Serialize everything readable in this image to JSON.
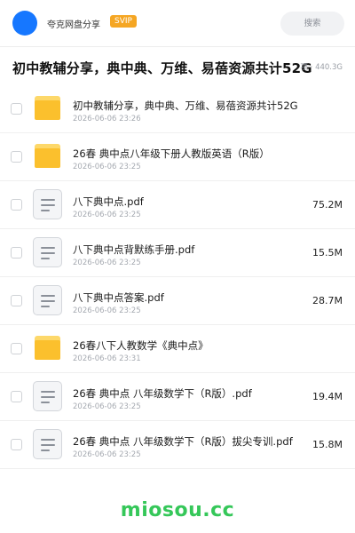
{
  "header": {
    "share_name": "夸克网盘分享",
    "badge": "SVIP",
    "search_label": "搜索"
  },
  "title": {
    "text": "初中教辅分享，典中典、万维、易蓓资源共计52G",
    "meta": "项 · 440.3G"
  },
  "files": [
    {
      "type": "folder",
      "name": "初中教辅分享，典中典、万维、易蓓资源共计52G",
      "date": "2026-06-06 23:26",
      "size": ""
    },
    {
      "type": "folder",
      "name": "26春 典中点八年级下册人教版英语（R版）",
      "date": "2026-06-06 23:25",
      "size": ""
    },
    {
      "type": "file",
      "name": "八下典中点.pdf",
      "date": "2026-06-06 23:25",
      "size": "75.2M"
    },
    {
      "type": "file",
      "name": "八下典中点背默练手册.pdf",
      "date": "2026-06-06 23:25",
      "size": "15.5M"
    },
    {
      "type": "file",
      "name": "八下典中点答案.pdf",
      "date": "2026-06-06 23:25",
      "size": "28.7M"
    },
    {
      "type": "folder",
      "name": "26春八下人教数学《典中点》",
      "date": "2026-06-06 23:31",
      "size": ""
    },
    {
      "type": "file",
      "name": "26春 典中点 八年级数学下（R版）.pdf",
      "date": "2026-06-06 23:25",
      "size": "19.4M"
    },
    {
      "type": "file",
      "name": "26春 典中点 八年级数学下（R版）拔尖专训.pdf",
      "date": "2026-06-06 23:25",
      "size": "15.8M"
    }
  ],
  "watermark": "miosou.cc",
  "colors": {
    "avatar": "#1677ff",
    "badge": "#f5a623",
    "folder": "#fbc02d",
    "watermark": "#35c759"
  }
}
